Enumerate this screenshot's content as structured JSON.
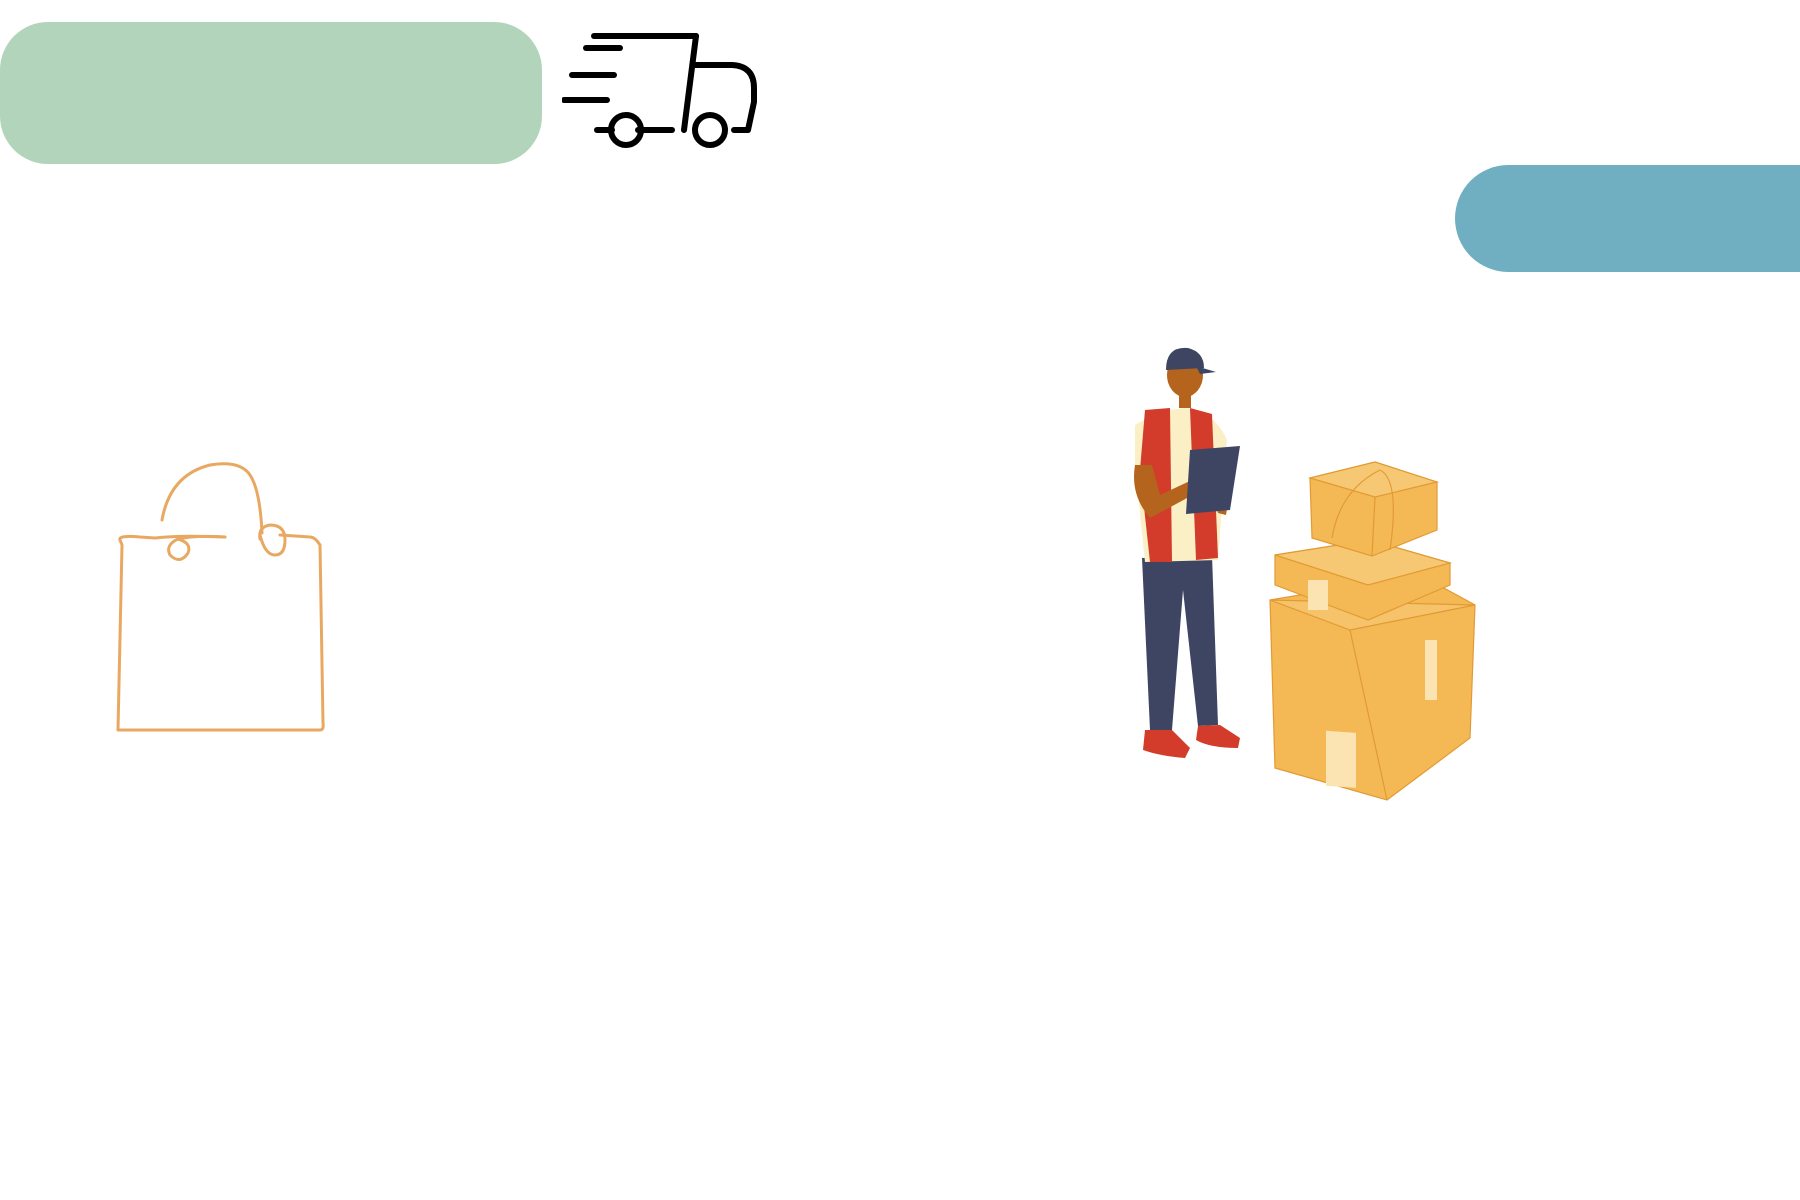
{
  "colors": {
    "pill_green": "#b1d4bb",
    "pill_blue": "#6fafc1",
    "bag_stroke": "#e9a862",
    "box_fill": "#f4b955",
    "box_highlight": "#fce3b2",
    "vest_red": "#d33b2a",
    "pants_navy": "#3e4563",
    "skin": "#b5641d",
    "shirt_cream": "#fbefc6",
    "truck_stroke": "#000000"
  },
  "icons": {
    "truck": "fast-delivery-truck-icon",
    "bag": "shopping-bag-icon"
  },
  "illustration": {
    "subject": "delivery-person-with-boxes"
  }
}
